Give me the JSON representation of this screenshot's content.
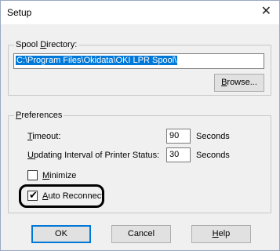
{
  "window": {
    "title": "Setup"
  },
  "spool": {
    "group_label_pre": "Spool ",
    "group_label_ul": "D",
    "group_label_post": "irectory:",
    "path_value": "C:\\Program Files\\Okidata\\OKI LPR Spool\\",
    "browse_ul": "B",
    "browse_rest": "rowse..."
  },
  "preferences": {
    "group_label_ul": "P",
    "group_label_rest": "references",
    "timeout_ul": "T",
    "timeout_rest": "imeout:",
    "timeout_value": "90",
    "timeout_unit": "Seconds",
    "update_ul": "U",
    "update_rest": "pdating Interval of Printer Status:",
    "update_value": "30",
    "update_unit": "Seconds",
    "minimize_ul": "M",
    "minimize_rest": "inimize",
    "minimize_checked": false,
    "autoreconnect_ul": "A",
    "autoreconnect_rest": "uto Reconnect",
    "autoreconnect_checked": true
  },
  "buttons": {
    "ok": "OK",
    "cancel": "Cancel",
    "help_ul": "H",
    "help_rest": "elp"
  }
}
